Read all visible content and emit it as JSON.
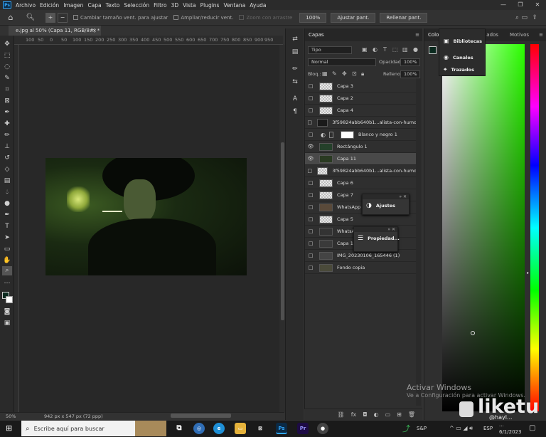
{
  "menubar": {
    "app_icon": "Ps",
    "items": [
      "Archivo",
      "Edición",
      "Imagen",
      "Capa",
      "Texto",
      "Selección",
      "Filtro",
      "3D",
      "Vista",
      "Plugins",
      "Ventana",
      "Ayuda"
    ],
    "window_controls": [
      "—",
      "❐",
      "✕"
    ]
  },
  "options_bar": {
    "resize_windows": "Cambiar tamaño vent. para ajustar",
    "zoom_all": "Ampliar/reducir vent.",
    "scrubby_zoom": "Zoom con arrastre",
    "zoom_level": "100%",
    "fit_screen": "Ajustar pant.",
    "fill_screen": "Rellenar pant."
  },
  "document_tab": {
    "title": "e.jpg al 50% (Capa 11, RGB/8#) *",
    "close": "×"
  },
  "ruler": [
    "100",
    "50",
    "0",
    "50",
    "100",
    "150",
    "200",
    "250",
    "300",
    "350",
    "400",
    "450",
    "500",
    "550",
    "600",
    "650",
    "700",
    "750",
    "800",
    "850",
    "900",
    "950",
    "1000"
  ],
  "status": {
    "zoom": "50%",
    "dimensions": "942 px x 547 px (72 ppp)"
  },
  "layers_panel": {
    "tab": "Capas",
    "kind_filter": "Tipo",
    "blend_mode": "Normal",
    "opacity_label": "Opacidad:",
    "opacity_value": "100%",
    "lock_label": "Bloq.:",
    "fill_label": "Relleno:",
    "fill_value": "100%",
    "layers": [
      {
        "name": "Capa 3",
        "visible": false,
        "selected": false
      },
      {
        "name": "Capa 2",
        "visible": false,
        "selected": false
      },
      {
        "name": "Capa 4",
        "visible": false,
        "selected": false
      },
      {
        "name": "3f59824abb640b1...alista-con-humo",
        "visible": false,
        "selected": false
      },
      {
        "name": "Blanco y negro 1",
        "visible": false,
        "selected": false
      },
      {
        "name": "Rectángulo 1",
        "visible": true,
        "selected": false
      },
      {
        "name": "Capa 11",
        "visible": true,
        "selected": true
      },
      {
        "name": "3f59824abb640b1...alista-con-humo",
        "visible": false,
        "selected": false
      },
      {
        "name": "Capa 6",
        "visible": false,
        "selected": false
      },
      {
        "name": "Capa 7",
        "visible": false,
        "selected": false
      },
      {
        "name": "WhatsApp Im",
        "visible": false,
        "selected": false
      },
      {
        "name": "Capa 5",
        "visible": false,
        "selected": false
      },
      {
        "name": "WhatsApp",
        "visible": false,
        "selected": false
      },
      {
        "name": "Capa 1",
        "visible": false,
        "selected": false
      },
      {
        "name": "IMG_20230106_165446 (1)",
        "visible": false,
        "selected": false
      },
      {
        "name": "Fondo copia",
        "visible": false,
        "selected": false
      }
    ],
    "footer_icons": [
      "link-icon",
      "fx-icon",
      "mask-icon",
      "adjustment-icon",
      "folder-icon",
      "new-layer-icon",
      "trash-icon"
    ]
  },
  "floating_panels": {
    "ajustes": "Ajustes",
    "propiedades": "Propiedad..."
  },
  "color_panel": {
    "tab_color": "Color",
    "tab_hidden": "ados",
    "tab_motivos": "Motivos",
    "foreground": "#0b2a1f"
  },
  "side_menu": {
    "items": [
      "Bibliotecas",
      "Canales",
      "Trazados"
    ]
  },
  "watermark": {
    "line1": "Activar Windows",
    "line2": "Ve a Configuración para activar Windows.",
    "brand": "liketu",
    "user": "@hayl..."
  },
  "taskbar": {
    "search_placeholder": "Escribe aquí para buscar",
    "stock_label": "S&P",
    "language": "ESP",
    "time": "...",
    "date": "6/1/2023"
  }
}
